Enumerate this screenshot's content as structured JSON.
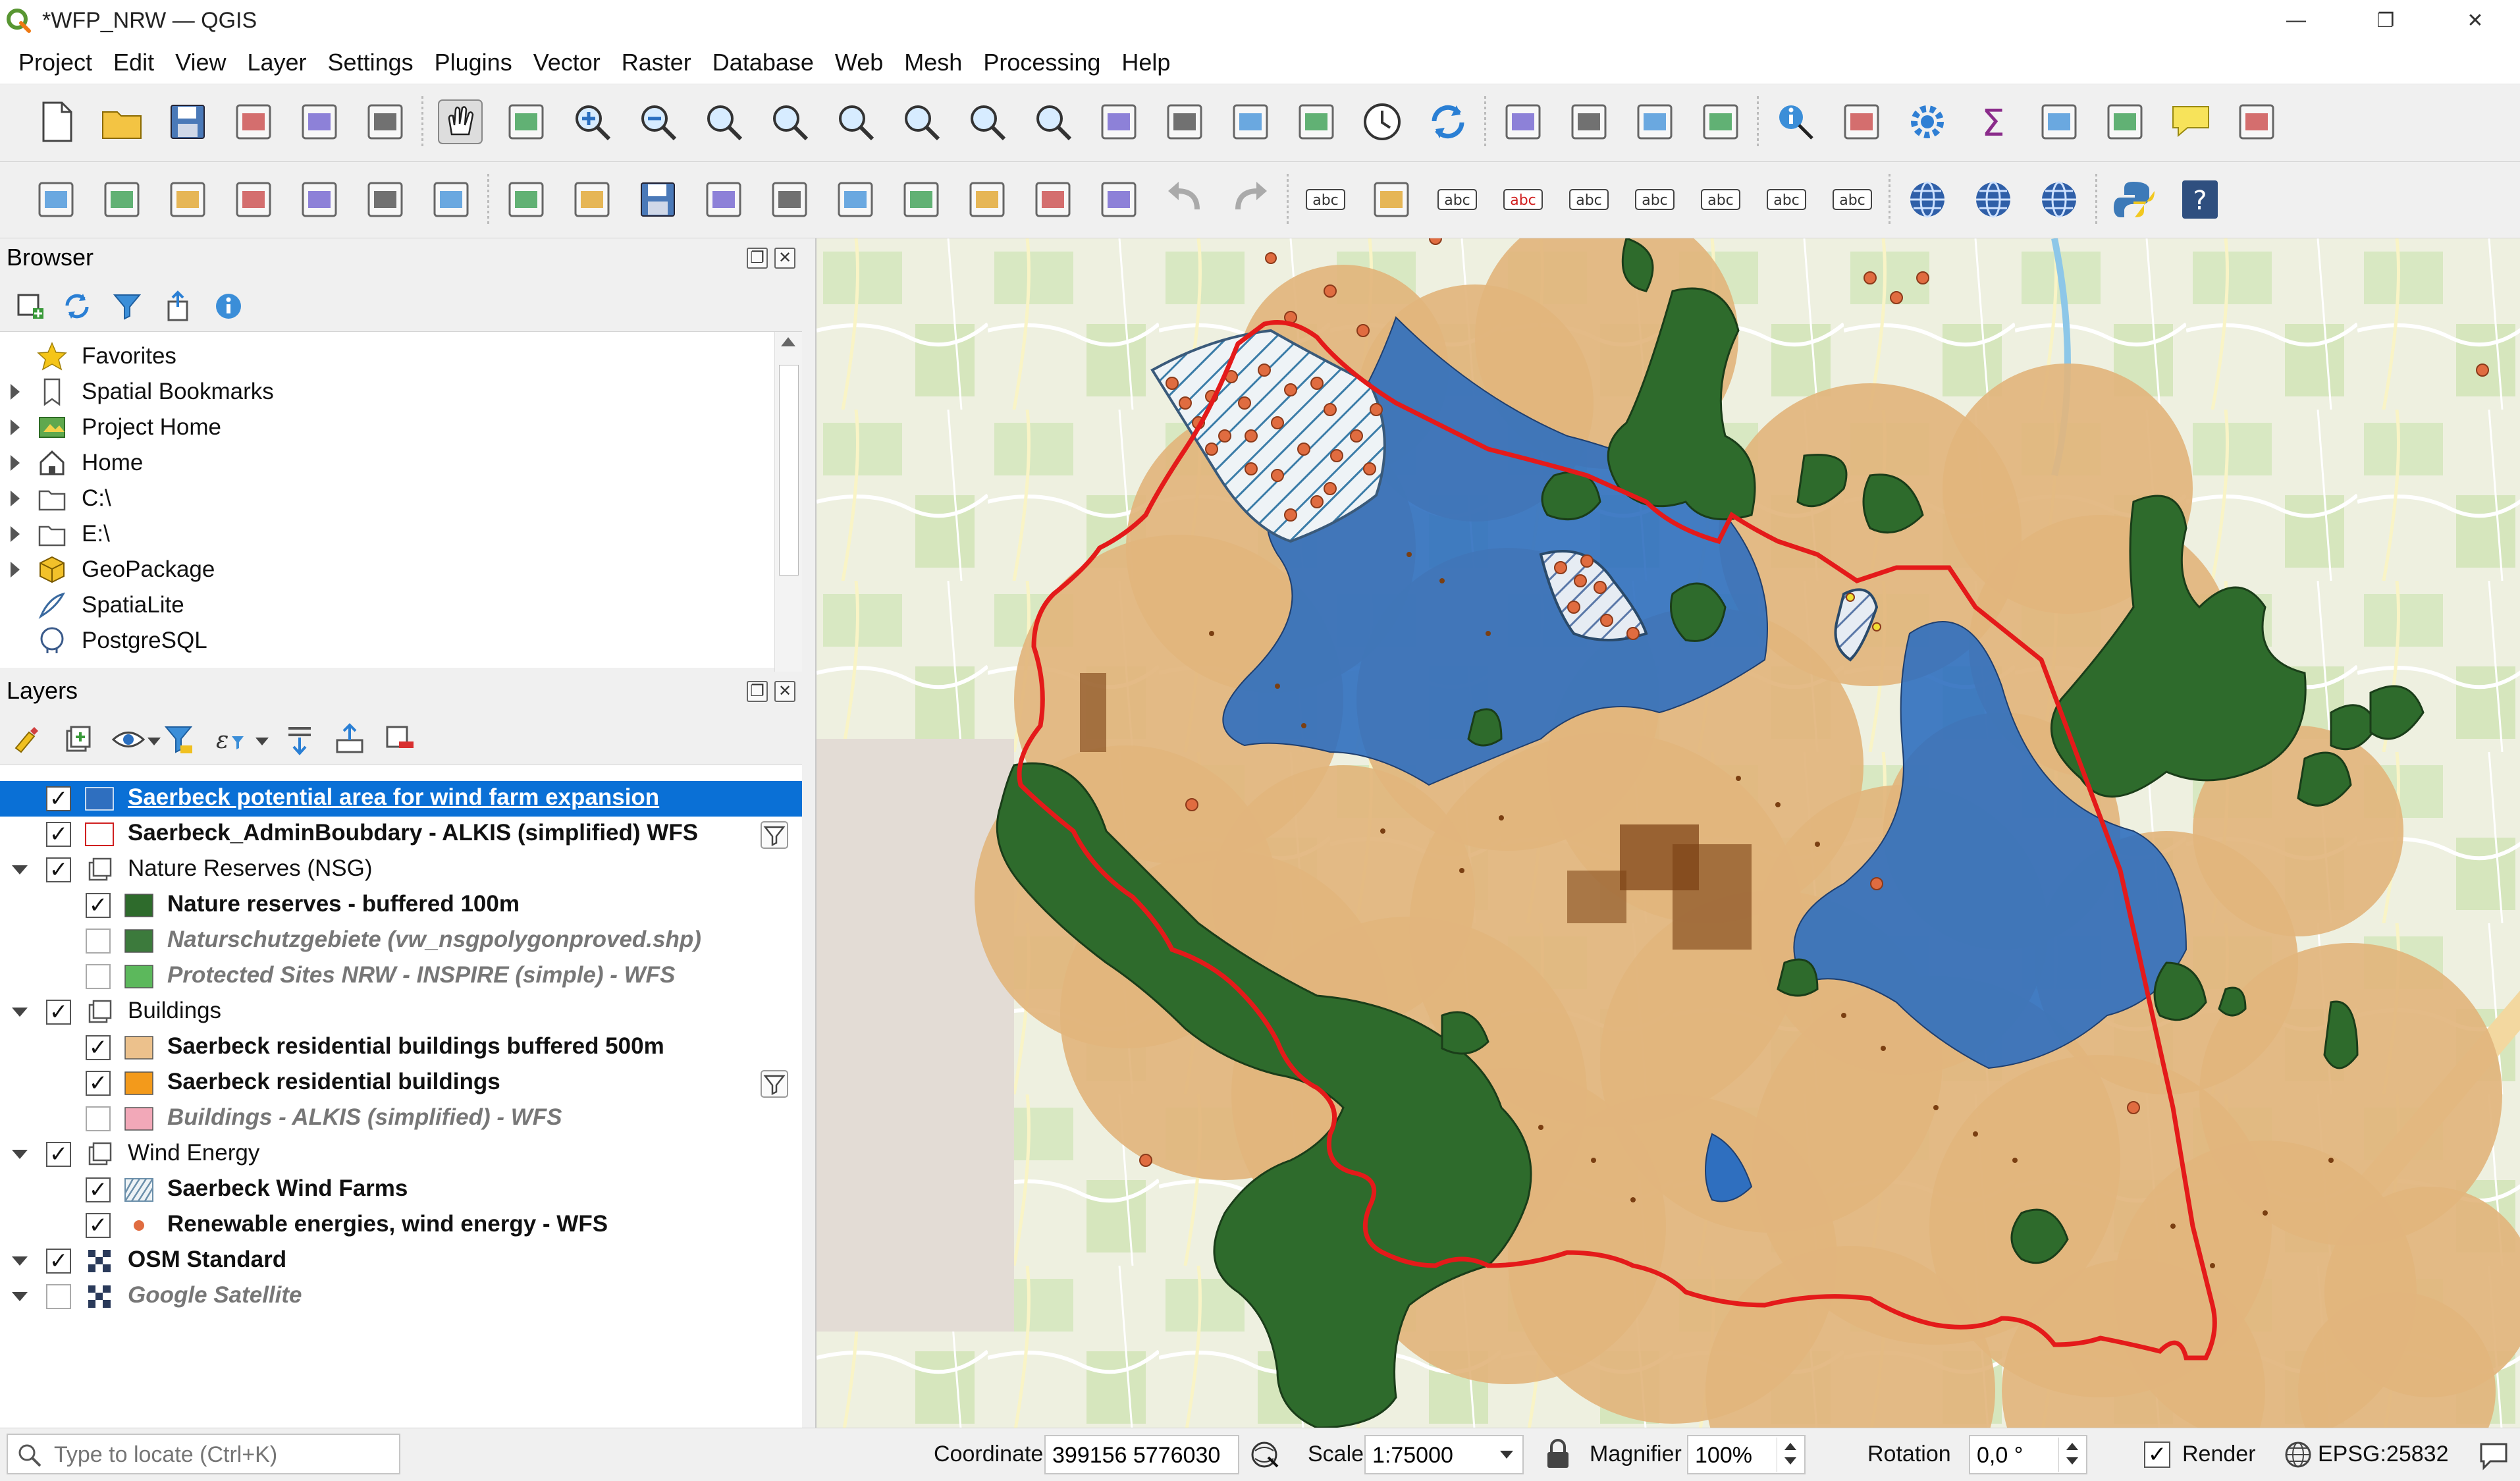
{
  "window": {
    "title": "*WFP_NRW — QGIS",
    "minimize": "—",
    "restore": "❐",
    "close": "✕"
  },
  "menu": [
    "Project",
    "Edit",
    "View",
    "Layer",
    "Settings",
    "Plugins",
    "Vector",
    "Raster",
    "Database",
    "Web",
    "Mesh",
    "Processing",
    "Help"
  ],
  "toolbar_icons": {
    "row1": [
      "new-project-icon",
      "open-project-icon",
      "save-project-icon",
      "new-print-layout-icon",
      "layout-manager-icon",
      "style-manager-icon",
      "pan-hand-icon",
      "pan-to-selection-icon",
      "zoom-in-icon",
      "zoom-out-icon",
      "zoom-full-icon",
      "zoom-to-selection-icon",
      "zoom-to-layer-icon",
      "zoom-native-icon",
      "zoom-last-icon",
      "zoom-next-icon",
      "new-map-view-icon",
      "new-3d-view-icon",
      "new-bookmark-icon",
      "show-bookmarks-icon",
      "temporal-controller-icon",
      "refresh-icon",
      "select-features-icon",
      "select-by-expression-icon",
      "deselect-all-icon",
      "select-by-location-icon",
      "identify-icon",
      "attribute-table-stats-icon",
      "settings-gear-icon",
      "sum-statistics-icon",
      "open-attribute-table-icon",
      "measure-line-icon",
      "map-tips-icon",
      "locator-filter-icon"
    ],
    "row2": [
      "add-vector-layer-icon",
      "add-geopackage-layer-icon",
      "add-delimited-text-icon",
      "add-spatialite-icon",
      "add-virtual-layer-icon",
      "add-wms-layer-icon",
      "add-wfs-layer-icon",
      "current-edits-icon",
      "toggle-editing-icon",
      "save-edits-icon",
      "digitize-icon",
      "vertex-tool-icon",
      "modify-attributes-icon",
      "delete-selected-icon",
      "cut-features-icon",
      "copy-features-icon",
      "paste-features-icon",
      "undo-icon",
      "redo-icon",
      "label-tool-icon",
      "diagram-options-icon",
      "label-pin-icon",
      "label-highlight-icon",
      "pin-labels-icon",
      "show-hide-labels-icon",
      "move-label-icon",
      "rotate-label-icon",
      "change-label-icon",
      "metasearch-icon",
      "metadata-catalog-icon",
      "quick-map-services-icon",
      "python-console-icon",
      "help-icon"
    ]
  },
  "browser": {
    "title": "Browser",
    "items": [
      {
        "label": "Favorites",
        "icon": "star-icon",
        "expandable": false
      },
      {
        "label": "Spatial Bookmarks",
        "icon": "bookmark-icon",
        "expandable": true
      },
      {
        "label": "Project Home",
        "icon": "project-home-icon",
        "expandable": true
      },
      {
        "label": "Home",
        "icon": "home-icon",
        "expandable": true
      },
      {
        "label": "C:\\",
        "icon": "drive-icon",
        "expandable": true
      },
      {
        "label": "E:\\",
        "icon": "drive-icon",
        "expandable": true
      },
      {
        "label": "GeoPackage",
        "icon": "geopackage-icon",
        "expandable": true
      },
      {
        "label": "SpatiaLite",
        "icon": "spatialite-icon",
        "expandable": false
      },
      {
        "label": "PostgreSQL",
        "icon": "postgresql-icon",
        "expandable": false
      }
    ]
  },
  "layers": {
    "title": "Layers",
    "items": [
      {
        "label": "Saerbeck potential area for wind farm expansion",
        "checked": true,
        "style": "sel",
        "indent": 0,
        "symbol": "#2f6fbf",
        "expander": false,
        "filter": false
      },
      {
        "label": "Saerbeck_AdminBoubdary - ALKIS (simplified) WFS",
        "checked": true,
        "style": "bold",
        "indent": 0,
        "symbol": "outline-red",
        "expander": false,
        "filter": true
      },
      {
        "label": "Nature Reserves (NSG)",
        "checked": true,
        "style": "group",
        "indent": 0,
        "symbol": "group",
        "expander": true,
        "filter": false
      },
      {
        "label": "Nature reserves - buffered 100m",
        "checked": true,
        "style": "bold",
        "indent": 1,
        "symbol": "#2e6b2c",
        "expander": false,
        "filter": false
      },
      {
        "label": "Naturschutzgebiete (vw_nsgpolygonproved.shp)",
        "checked": false,
        "style": "italic",
        "indent": 1,
        "symbol": "#3c7a3c",
        "expander": false,
        "filter": false
      },
      {
        "label": "Protected Sites NRW - INSPIRE (simple) - WFS",
        "checked": false,
        "style": "italic",
        "indent": 1,
        "symbol": "#5cb85c",
        "expander": false,
        "filter": false
      },
      {
        "label": "Buildings",
        "checked": true,
        "style": "group",
        "indent": 0,
        "symbol": "group",
        "expander": true,
        "filter": false
      },
      {
        "label": "Saerbeck residential buildings buffered 500m",
        "checked": true,
        "style": "bold",
        "indent": 1,
        "symbol": "#ecc18c",
        "expander": false,
        "filter": false
      },
      {
        "label": "Saerbeck residential buildings",
        "checked": true,
        "style": "bold",
        "indent": 1,
        "symbol": "#f39a1b",
        "expander": false,
        "filter": true
      },
      {
        "label": "Buildings - ALKIS (simplified) - WFS",
        "checked": false,
        "style": "italic",
        "indent": 1,
        "symbol": "#f2a8b8",
        "expander": false,
        "filter": false
      },
      {
        "label": "Wind Energy",
        "checked": true,
        "style": "group",
        "indent": 0,
        "symbol": "group",
        "expander": true,
        "filter": false
      },
      {
        "label": "Saerbeck Wind Farms",
        "checked": true,
        "style": "bold",
        "indent": 1,
        "symbol": "hatch",
        "expander": false,
        "filter": false
      },
      {
        "label": "Renewable energies, wind energy - WFS",
        "checked": true,
        "style": "bold",
        "indent": 1,
        "symbol": "dot",
        "expander": false,
        "filter": false
      },
      {
        "label": "OSM Standard",
        "checked": true,
        "style": "bold",
        "indent": 0,
        "symbol": "raster",
        "expander": true,
        "filter": false
      },
      {
        "label": "Google Satellite",
        "checked": false,
        "style": "italic",
        "indent": 0,
        "symbol": "raster",
        "expander": true,
        "filter": false
      }
    ]
  },
  "status": {
    "locator_placeholder": "Type to locate (Ctrl+K)",
    "coordinate_label": "Coordinate",
    "coordinate_value": "399156  5776030",
    "scale_label": "Scale",
    "scale_value": "1:75000",
    "magnifier_label": "Magnifier",
    "magnifier_value": "100%",
    "rotation_label": "Rotation",
    "rotation_value": "0,0 °",
    "render_label": "Render",
    "render_checked": true,
    "crs": "EPSG:25832"
  },
  "colors": {
    "potential_area": "#2f6fbf",
    "nature_reserve": "#2e6b2c",
    "building_buffer": "#e2b57d",
    "admin_boundary": "#e41a1a",
    "wind_turbine": "#e06c40",
    "selection_blue": "#0a70d6"
  }
}
